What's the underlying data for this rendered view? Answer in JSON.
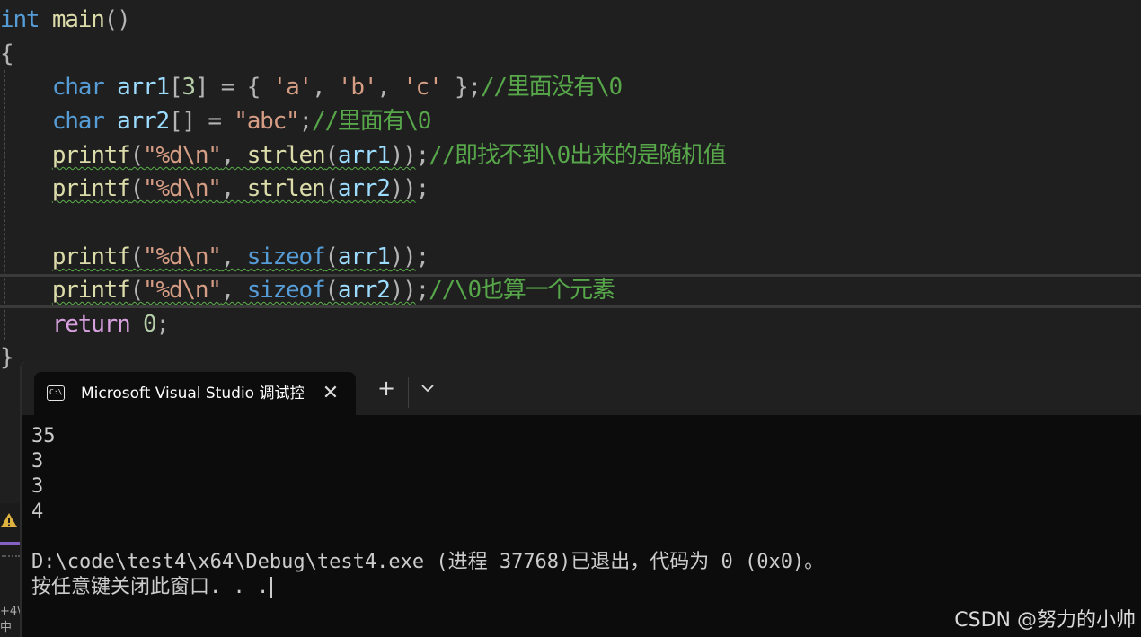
{
  "editor": {
    "lines": [
      [
        {
          "t": "int",
          "c": "kw"
        },
        {
          "t": " ",
          "c": ""
        },
        {
          "t": "main",
          "c": "fn"
        },
        {
          "t": "()",
          "c": "pun"
        }
      ],
      [
        {
          "t": "{",
          "c": "pun"
        }
      ],
      [
        {
          "t": "    "
        },
        {
          "t": "char",
          "c": "kw"
        },
        {
          "t": " "
        },
        {
          "t": "arr1",
          "c": "var"
        },
        {
          "t": "[",
          "c": "pun"
        },
        {
          "t": "3",
          "c": "num"
        },
        {
          "t": "] = { ",
          "c": "pun"
        },
        {
          "t": "'a'",
          "c": "str"
        },
        {
          "t": ", ",
          "c": "pun"
        },
        {
          "t": "'b'",
          "c": "str"
        },
        {
          "t": ", ",
          "c": "pun"
        },
        {
          "t": "'c'",
          "c": "str"
        },
        {
          "t": " };",
          "c": "pun"
        },
        {
          "t": "//里面没有\\0",
          "c": "cmt"
        }
      ],
      [
        {
          "t": "    "
        },
        {
          "t": "char",
          "c": "kw"
        },
        {
          "t": " "
        },
        {
          "t": "arr2",
          "c": "var"
        },
        {
          "t": "[] = ",
          "c": "pun"
        },
        {
          "t": "\"abc\"",
          "c": "str"
        },
        {
          "t": ";",
          "c": "pun"
        },
        {
          "t": "//里面有\\0",
          "c": "cmt"
        }
      ],
      [
        {
          "t": "    "
        },
        {
          "t": "printf",
          "c": "fn",
          "sq": true
        },
        {
          "t": "(",
          "c": "pun",
          "sq": true
        },
        {
          "t": "\"%d\\n\"",
          "c": "str",
          "sq": true
        },
        {
          "t": ", ",
          "c": "pun",
          "sq": true
        },
        {
          "t": "strlen",
          "c": "fn",
          "sq": true
        },
        {
          "t": "(",
          "c": "pun",
          "sq": true
        },
        {
          "t": "arr1",
          "c": "var",
          "sq": true
        },
        {
          "t": "))",
          "c": "pun",
          "sq": true
        },
        {
          "t": ";",
          "c": "pun"
        },
        {
          "t": "//即找不到\\0出来的是随机值",
          "c": "cmt"
        }
      ],
      [
        {
          "t": "    "
        },
        {
          "t": "printf",
          "c": "fn",
          "sq": true
        },
        {
          "t": "(",
          "c": "pun",
          "sq": true
        },
        {
          "t": "\"%d\\n\"",
          "c": "str",
          "sq": true
        },
        {
          "t": ", ",
          "c": "pun",
          "sq": true
        },
        {
          "t": "strlen",
          "c": "fn",
          "sq": true
        },
        {
          "t": "(",
          "c": "pun",
          "sq": true
        },
        {
          "t": "arr2",
          "c": "var",
          "sq": true
        },
        {
          "t": "))",
          "c": "pun",
          "sq": true
        },
        {
          "t": ";",
          "c": "pun"
        }
      ],
      [],
      [
        {
          "t": "    "
        },
        {
          "t": "printf",
          "c": "fn",
          "sq": true
        },
        {
          "t": "(",
          "c": "pun",
          "sq": true
        },
        {
          "t": "\"%d\\n\"",
          "c": "str",
          "sq": true
        },
        {
          "t": ", ",
          "c": "pun",
          "sq": true
        },
        {
          "t": "sizeof",
          "c": "kw",
          "sq": true
        },
        {
          "t": "(",
          "c": "pun",
          "sq": true
        },
        {
          "t": "arr1",
          "c": "var",
          "sq": true
        },
        {
          "t": "))",
          "c": "pun",
          "sq": true
        },
        {
          "t": ";",
          "c": "pun"
        }
      ],
      [
        {
          "t": "    "
        },
        {
          "t": "printf",
          "c": "fn",
          "sq": true
        },
        {
          "t": "(",
          "c": "pun",
          "sq": true
        },
        {
          "t": "\"%d\\n\"",
          "c": "str",
          "sq": true
        },
        {
          "t": ", ",
          "c": "pun",
          "sq": true
        },
        {
          "t": "sizeof",
          "c": "kw",
          "sq": true
        },
        {
          "t": "(",
          "c": "pun",
          "sq": true
        },
        {
          "t": "arr2",
          "c": "var",
          "sq": true
        },
        {
          "t": "))",
          "c": "pun",
          "sq": true
        },
        {
          "t": ";",
          "c": "pun"
        },
        {
          "t": "//\\0也算一个元素",
          "c": "cmt"
        }
      ],
      [
        {
          "t": "    "
        },
        {
          "t": "return",
          "c": "ctl"
        },
        {
          "t": " "
        },
        {
          "t": "0",
          "c": "num"
        },
        {
          "t": ";",
          "c": "pun"
        }
      ],
      [
        {
          "t": "}",
          "c": "pun"
        }
      ]
    ]
  },
  "terminal": {
    "tab_icon": "C:\\",
    "tab_title": "Microsoft Visual Studio 调试控制台",
    "close_glyph": "✕",
    "new_tab_glyph": "+",
    "output_lines": [
      "35",
      "3",
      "3",
      "4",
      "",
      "D:\\code\\test4\\x64\\Debug\\test4.exe (进程 37768)已退出，代码为 0 (0x0)。",
      "按任意键关闭此窗口. . ."
    ]
  },
  "left_strip": {
    "warn_icon": "warning-icon",
    "text": "+4\\\n中"
  },
  "watermark": "CSDN @努力的小帅",
  "colors": {
    "keyword": "#569cd6",
    "function": "#dcdcaa",
    "variable": "#9cdcfe",
    "string": "#d69d85",
    "comment": "#57a64a",
    "control": "#d8a0df",
    "squiggle": "#5bb04a",
    "accent": "#8661c5"
  }
}
